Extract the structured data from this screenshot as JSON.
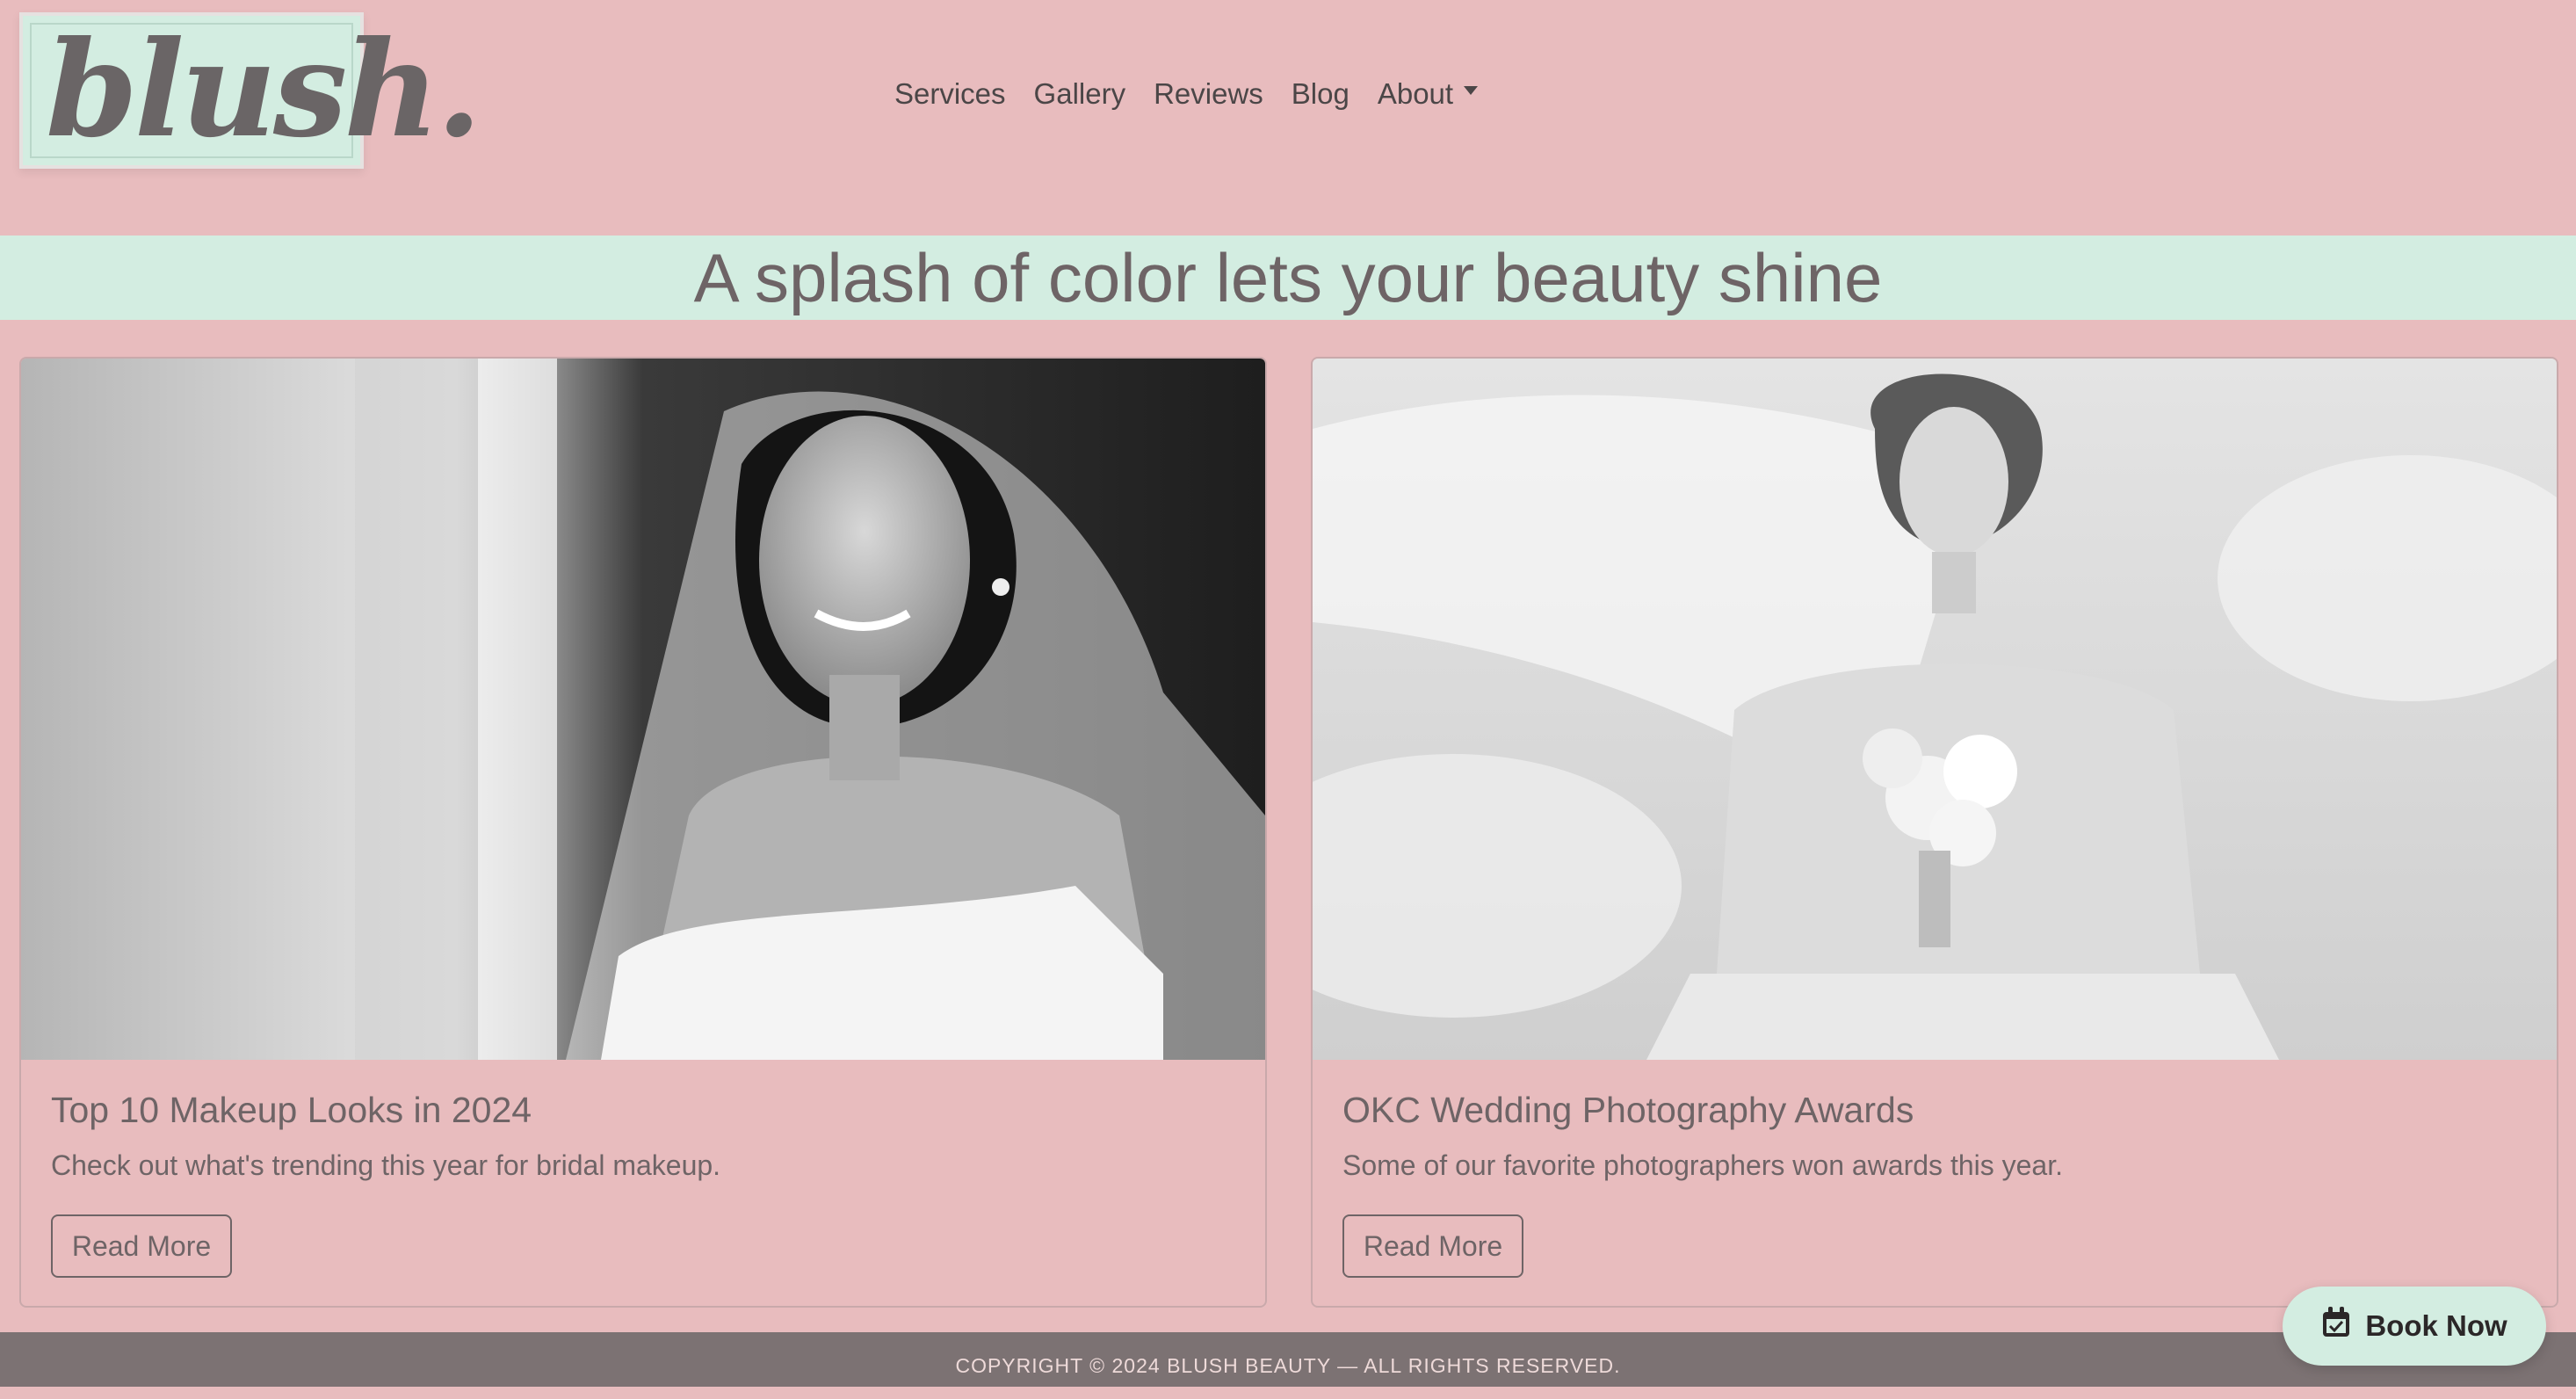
{
  "brand": {
    "logo_text": "blush."
  },
  "nav": {
    "items": [
      "Services",
      "Gallery",
      "Reviews",
      "Blog"
    ],
    "about": "About"
  },
  "banner": {
    "text": "A splash of color lets your beauty shine"
  },
  "cards": [
    {
      "title": "Top 10 Makeup Looks in 2024",
      "text": "Check out what's trending this year for bridal makeup.",
      "button": "Read More",
      "image_icon": "bride-smiling-photo"
    },
    {
      "title": "OKC Wedding Photography Awards",
      "text": "Some of our favorite photographers won awards this year.",
      "button": "Read More",
      "image_icon": "bride-with-bouquet-photo"
    }
  ],
  "footer": {
    "text": "COPYRIGHT © 2024 BLUSH BEAUTY — ALL RIGHTS RESERVED."
  },
  "book": {
    "label": "Book Now",
    "icon": "calendar-check-icon"
  },
  "colors": {
    "background": "#e8bcbe",
    "mint": "#d3ede1",
    "text": "#6e6466",
    "footer": "#7c7273"
  }
}
